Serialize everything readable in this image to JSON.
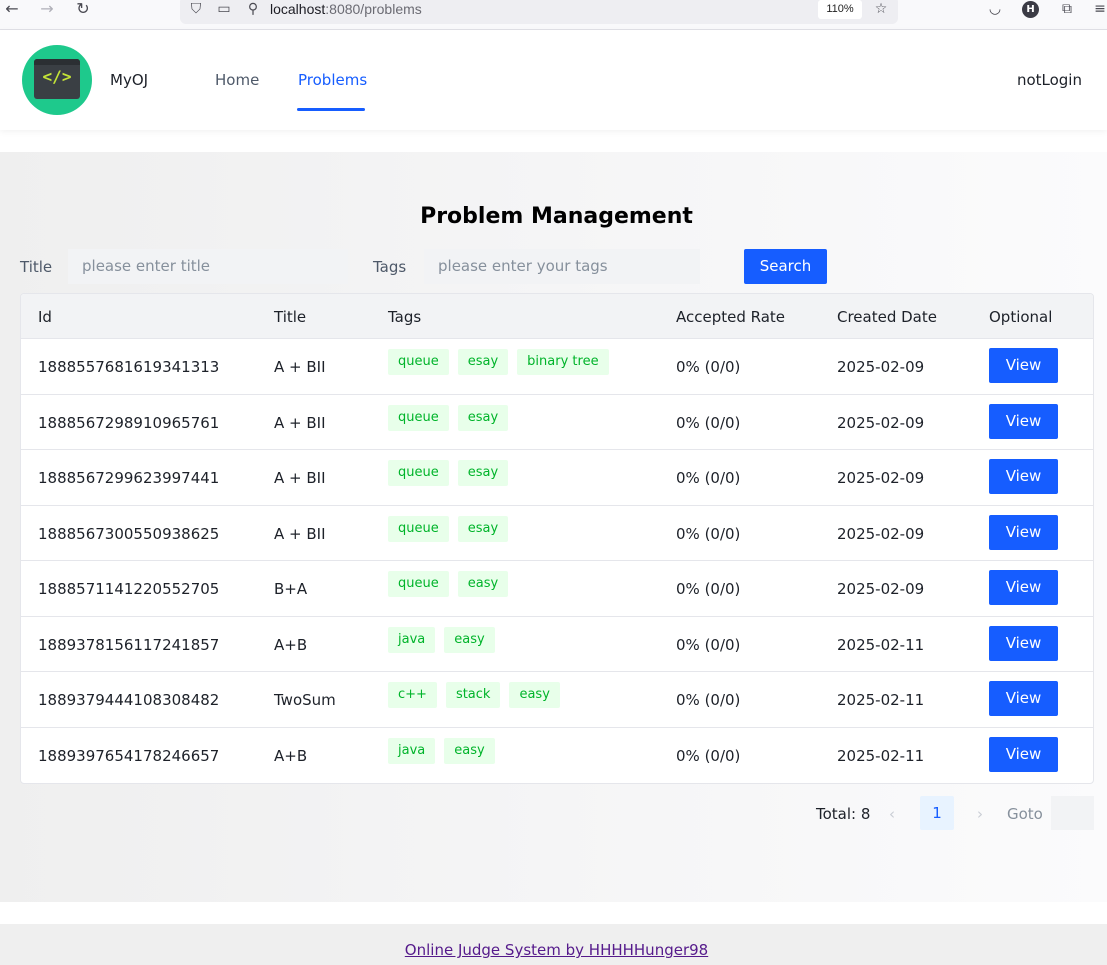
{
  "browser": {
    "url_host": "localhost",
    "url_path": ":8080/problems",
    "zoom": "110%",
    "profile_initial": "H"
  },
  "header": {
    "brand": "MyOJ",
    "menu": [
      {
        "label": "Home"
      },
      {
        "label": "Problems"
      }
    ],
    "user": "notLogin"
  },
  "page": {
    "title": "Problem Management"
  },
  "filters": {
    "title_label": "Title",
    "title_placeholder": "please enter title",
    "tags_label": "Tags",
    "tags_placeholder": "please enter your tags",
    "search_label": "Search"
  },
  "table": {
    "columns": [
      "Id",
      "Title",
      "Tags",
      "Accepted Rate",
      "Created Date",
      "Optional"
    ],
    "rows": [
      {
        "id": "1888557681619341313",
        "title": "A + BII",
        "tags": [
          "queue",
          "esay",
          "binary tree"
        ],
        "rate": "0% (0/0)",
        "date": "2025-02-09",
        "action": "View"
      },
      {
        "id": "1888567298910965761",
        "title": "A + BII",
        "tags": [
          "queue",
          "esay"
        ],
        "rate": "0% (0/0)",
        "date": "2025-02-09",
        "action": "View"
      },
      {
        "id": "1888567299623997441",
        "title": "A + BII",
        "tags": [
          "queue",
          "esay"
        ],
        "rate": "0% (0/0)",
        "date": "2025-02-09",
        "action": "View"
      },
      {
        "id": "1888567300550938625",
        "title": "A + BII",
        "tags": [
          "queue",
          "esay"
        ],
        "rate": "0% (0/0)",
        "date": "2025-02-09",
        "action": "View"
      },
      {
        "id": "1888571141220552705",
        "title": "B+A",
        "tags": [
          "queue",
          "easy"
        ],
        "rate": "0% (0/0)",
        "date": "2025-02-09",
        "action": "View"
      },
      {
        "id": "1889378156117241857",
        "title": "A+B",
        "tags": [
          "java",
          "easy"
        ],
        "rate": "0% (0/0)",
        "date": "2025-02-11",
        "action": "View"
      },
      {
        "id": "1889379444108308482",
        "title": "TwoSum",
        "tags": [
          "c++",
          "stack",
          "easy"
        ],
        "rate": "0% (0/0)",
        "date": "2025-02-11",
        "action": "View"
      },
      {
        "id": "1889397654178246657",
        "title": "A+B",
        "tags": [
          "java",
          "easy"
        ],
        "rate": "0% (0/0)",
        "date": "2025-02-11",
        "action": "View"
      }
    ]
  },
  "pagination": {
    "total": "Total: 8",
    "current_page": "1",
    "goto_label": "Goto"
  },
  "footer": {
    "link": "Online Judge System by HHHHHunger98"
  },
  "colors": {
    "primary": "#165dff",
    "tag_bg": "#e8ffea",
    "tag_text": "#00b42a",
    "logo_bg": "#1ec98c"
  }
}
